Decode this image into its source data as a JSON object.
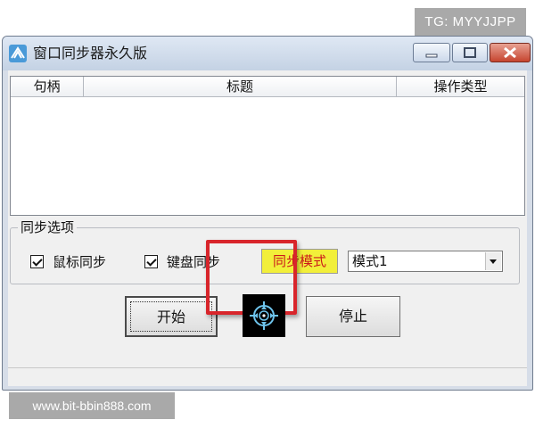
{
  "window": {
    "title": "窗口同步器永久版"
  },
  "list": {
    "columns": [
      "句柄",
      "标题",
      "操作类型"
    ],
    "rows": []
  },
  "sync_options": {
    "group_label": "同步选项",
    "mouse_sync": {
      "label": "鼠标同步",
      "checked": true
    },
    "keyboard_sync": {
      "label": "键盘同步",
      "checked": true
    },
    "mode_label": "同步模式",
    "mode_select": {
      "value": "模式1"
    }
  },
  "buttons": {
    "start": "开始",
    "stop": "停止"
  },
  "watermarks": {
    "top": "TG: MYYJJPP",
    "bottom": "www.bit-bbin888.com"
  },
  "colors": {
    "highlight": "#d8252b",
    "mode_label_bg": "#f2ef3a",
    "mode_label_text": "#cc1a1a"
  },
  "icons": {
    "app": "app-logo-icon",
    "target": "crosshair-target-icon"
  }
}
